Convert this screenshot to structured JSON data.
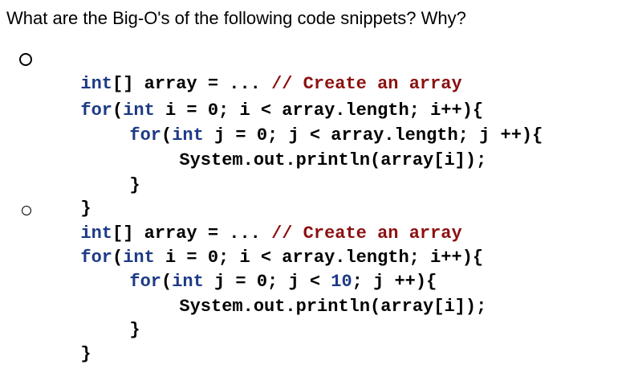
{
  "question": "What are the Big-O's of the following code snippets? Why?",
  "snippets": [
    {
      "lines": [
        {
          "kw": "int",
          "tx": "[] array = ... ",
          "cm": "// Create an array"
        },
        {
          "kw": "for",
          "tx": "(",
          "kw2": "int",
          "tx2": " i = 0; i < array.length; i++){"
        },
        {
          "kw": "for",
          "tx": "(",
          "kw2": "int",
          "tx2": " j = 0; j < array.length; j ++){"
        },
        {
          "tx": "System.out.println(array[i]);"
        },
        {
          "tx": "}"
        },
        {
          "tx": "}"
        }
      ]
    },
    {
      "lines": [
        {
          "kw": "int",
          "tx": "[] array = ... ",
          "cm": "// Create an array"
        },
        {
          "kw": "for",
          "tx": "(",
          "kw2": "int",
          "tx2": " i = 0; i < array.length; i++){"
        },
        {
          "kw": "for",
          "tx": "(",
          "kw2": "int",
          "tx2": " j = 0; j < ",
          "nm": "10",
          "tx3": "; j ++){"
        },
        {
          "tx": "System.out.println(array[i]);"
        },
        {
          "tx": "}"
        },
        {
          "tx": "}"
        }
      ]
    }
  ],
  "colors": {
    "keyword": "#1d3a87",
    "comment": "#8c1010",
    "text": "#000000"
  }
}
